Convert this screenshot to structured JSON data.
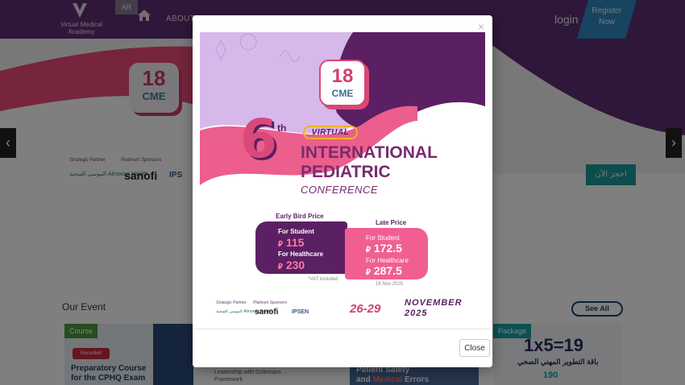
{
  "header": {
    "logo_text_line1": "Virtual Medical",
    "logo_text_line2": "Academy",
    "lang_label": "AR",
    "nav_about": "ABOUT",
    "login_label": "login",
    "register_line1": "Register",
    "register_line2": "Now"
  },
  "hero": {
    "badge_number": "18",
    "badge_text": "CME",
    "strategic_partner_label": "Strategic Partner",
    "platinum_sponsors_label": "Platinum Sponsors",
    "partner_name": "الموسى الصحية Almoosa Health",
    "sponsor_1": "sanofi",
    "sponsor_2": "IPS",
    "book_label": "احجز الآن"
  },
  "events": {
    "title": "Our Event",
    "see_all_label": "See All",
    "card1": {
      "tag": "Course",
      "badge": "Recorded",
      "title": "Preparatory Course for the CPHQ Exam"
    },
    "card2": {
      "text": "Leadership with Golemans Framework"
    },
    "card3": {
      "title_part1": "Patient Safety",
      "title_part2": "and",
      "title_red": "Medical",
      "title_part3": "Errors"
    },
    "card4": {
      "tag": "Package",
      "formula": "1x5=19",
      "arabic": "باقة التطوير المهني الصحي",
      "price": "190"
    }
  },
  "modal": {
    "close_x": "×",
    "close_label": "Close",
    "poster": {
      "badge_number": "18",
      "badge_text": "CME",
      "edition_number": "6",
      "edition_suffix": "th",
      "virtual_label": "VIRTUAL",
      "title_line1": "INTERNATIONAL",
      "title_line2": "PEDIATRIC",
      "title_line3": "CONFERENCE",
      "early_bird_label": "Early Bird Price",
      "late_price_label": "Late Price",
      "early_student_label": "For Student",
      "early_student_price": "115",
      "early_health_label": "For Healthcare",
      "early_health_price": "230",
      "late_student_label": "For Student",
      "late_student_price": "172.5",
      "late_health_label": "For Healthcare",
      "late_health_price": "287.5",
      "currency_symbol": "⃁",
      "vat_note": "*VAT Included",
      "late_date": "16 Nov 2025",
      "strategic_partner_label": "Strategic Partner",
      "platinum_sponsors_label": "Platinum Sponsors",
      "partner_name": "الموسى الصحية Almoosa Health",
      "sponsor_1": "sanofi",
      "sponsor_2": "IPSEN",
      "days": "26-29",
      "month": "NOVEMBER",
      "year": "2025"
    }
  },
  "colors": {
    "header_bg": "#5d2f73",
    "accent_pink": "#d23f70",
    "accent_purple": "#5b1f63",
    "register_blue": "#2e88c0",
    "teal": "#1a9a9a"
  }
}
